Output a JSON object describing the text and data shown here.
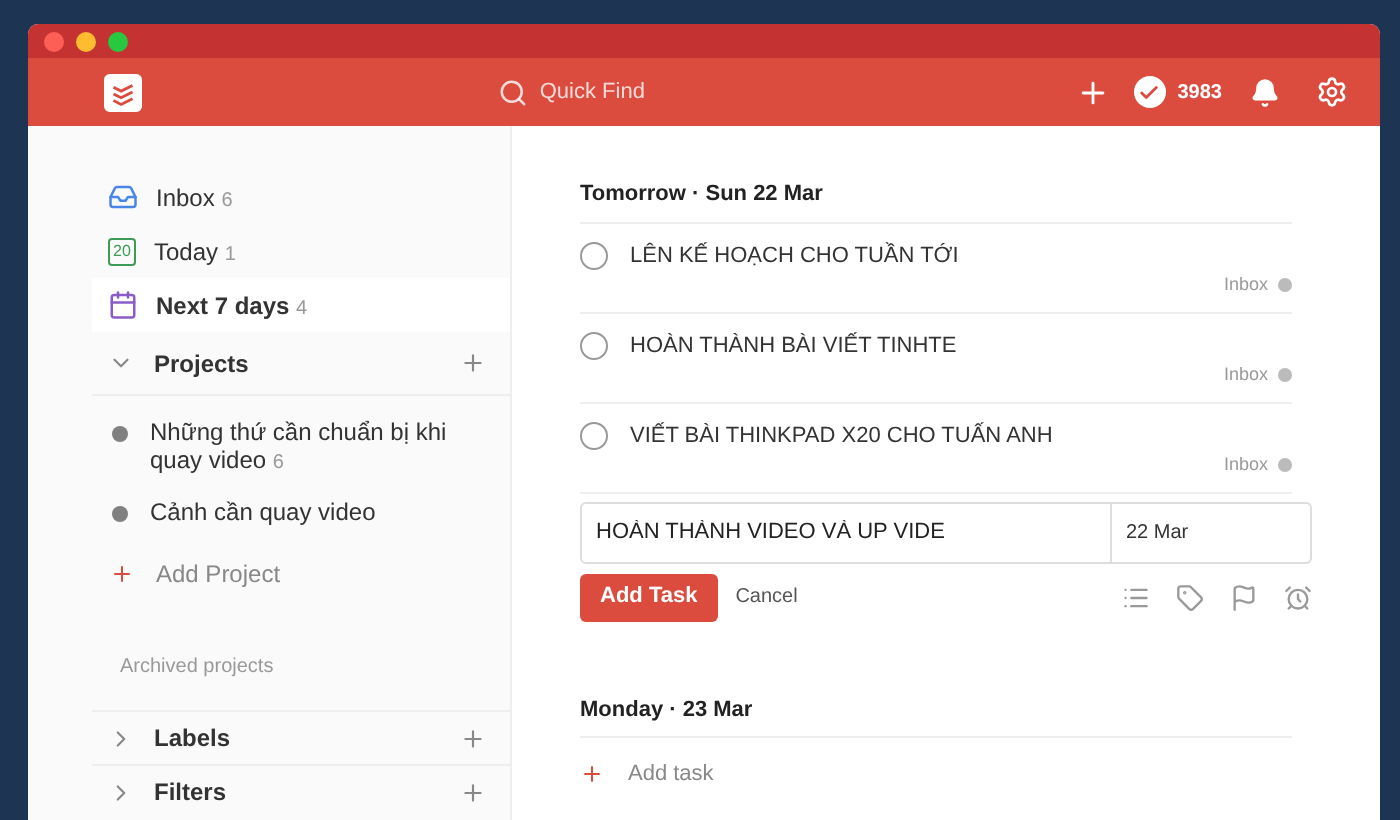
{
  "header": {
    "search_placeholder": "Quick Find",
    "karma": "3983"
  },
  "sidebar": {
    "nav": [
      {
        "kind": "inbox",
        "label": "Inbox",
        "count": "6",
        "selected": false
      },
      {
        "kind": "today",
        "label": "Today",
        "count": "1",
        "selected": false,
        "icon_text": "20"
      },
      {
        "kind": "upcoming",
        "label": "Next 7 days",
        "count": "4",
        "selected": true
      }
    ],
    "projects": {
      "title": "Projects",
      "expanded": true,
      "items": [
        {
          "name": "Những thứ cần chuẩn bị khi quay video",
          "count": "6",
          "color": "#808080"
        },
        {
          "name": "Cảnh cần quay video",
          "color": "#808080"
        }
      ],
      "add_label": "Add Project",
      "archived_label": "Archived projects"
    },
    "sections": [
      {
        "title": "Labels",
        "expanded": false
      },
      {
        "title": "Filters",
        "expanded": false
      }
    ]
  },
  "days": [
    {
      "title": "Tomorrow · Sun 22 Mar",
      "tasks": [
        {
          "text": "LÊN KẾ HOẠCH CHO TUẦN TỚI",
          "project": "Inbox",
          "checked": false
        },
        {
          "text": "HOÀN THÀNH BÀI VIẾT TINHTE",
          "project": "Inbox",
          "checked": false
        },
        {
          "text": "VIẾT BÀI THINKPAD X20 CHO TUẤN ANH",
          "project": "Inbox",
          "checked": false
        }
      ],
      "editor": {
        "value": "HOÀN THÀNH VIDEO VÀ UP VIDE",
        "date": "22 Mar",
        "submit": "Add Task",
        "cancel": "Cancel"
      }
    },
    {
      "title": "Monday · 23 Mar",
      "add_label": "Add task"
    }
  ]
}
